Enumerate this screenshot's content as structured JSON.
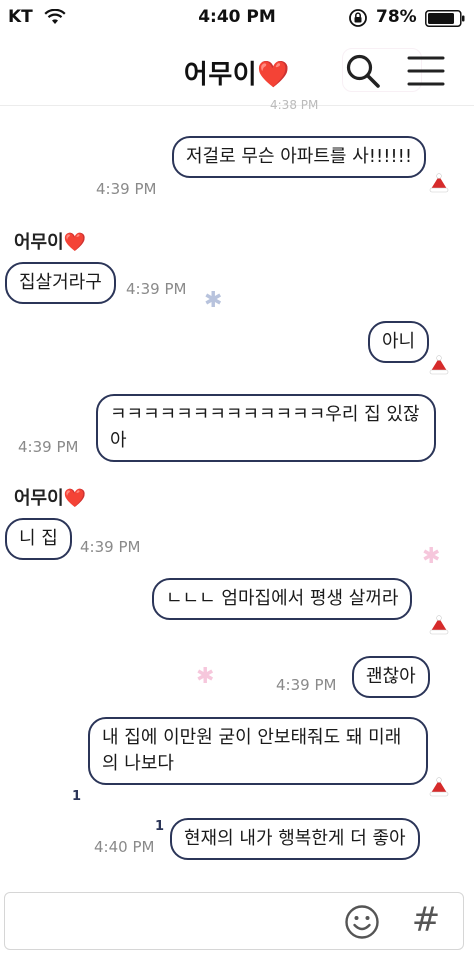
{
  "status_bar": {
    "carrier": "KT",
    "time": "4:40 PM",
    "battery_percent": "78%"
  },
  "header": {
    "title": "어무이❤️",
    "search_icon": "search-icon",
    "menu_icon": "hamburger-menu-icon",
    "faded_time": "4:38 PM"
  },
  "messages": [
    {
      "side": "me",
      "text": "저걸로 무슨 아파트를 사!!!!!!",
      "time": "4:39 PM"
    },
    {
      "side": "them",
      "sender": "어무이❤️",
      "text": "집살거라구",
      "time": "4:39 PM"
    },
    {
      "side": "me",
      "text": "아니"
    },
    {
      "side": "me",
      "text": "ㅋㅋㅋㅋㅋㅋㅋㅋㅋㅋㅋㅋㅋ우리 집 있잖아",
      "time": "4:39 PM"
    },
    {
      "side": "them",
      "sender": "어무이❤️",
      "text": "니 집",
      "time": "4:39 PM"
    },
    {
      "side": "me",
      "text": "ㄴㄴㄴ 엄마집에서  평생 살꺼라"
    },
    {
      "side": "me",
      "text": "괜찮아",
      "time": "4:39 PM"
    },
    {
      "side": "me",
      "text": "내 집에 이만원 굳이 안보태줘도 돼 미래의 나보다",
      "unread": "1"
    },
    {
      "side": "me",
      "text": "현재의 내가 행복한게 더 좋아",
      "time": "4:40 PM",
      "unread": "1"
    }
  ],
  "input_bar": {
    "emoji_icon": "emoji-icon",
    "hashtag_label": "#"
  },
  "colors": {
    "bubble_border": "#2b3558",
    "timestamp": "#8a8a8a",
    "santa_hat_red": "#d62b2b"
  }
}
